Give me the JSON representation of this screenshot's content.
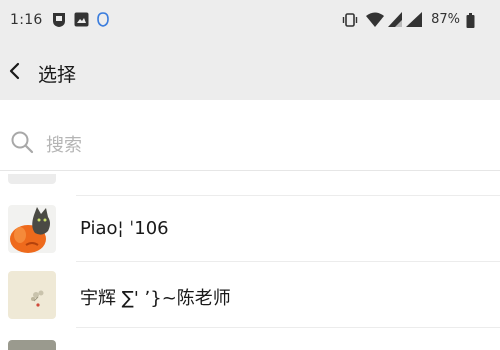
{
  "status_bar": {
    "time": "1:16",
    "battery_percent": "87%",
    "icons": [
      "shield-notification-icon",
      "image-notification-icon",
      "chat-notification-icon",
      "vibrate-icon",
      "wifi-icon",
      "signal-icon",
      "signal-icon-2",
      "battery-icon"
    ]
  },
  "header": {
    "back_icon": "chevron-left-icon",
    "title": "选择"
  },
  "search": {
    "icon": "search-icon",
    "placeholder": "搜索"
  },
  "contacts": [
    {
      "name": "Piao¦ ˈ106",
      "avatar": "orange-cat-avatar"
    },
    {
      "name": "宇辉  ∑' ʼ}~陈老师",
      "avatar": "beige-sketch-avatar"
    }
  ],
  "colors": {
    "header_bg": "#ededed",
    "list_bg": "#ffffff",
    "divider": "#ececec",
    "placeholder": "#b5b5b5",
    "text": "#191919"
  }
}
